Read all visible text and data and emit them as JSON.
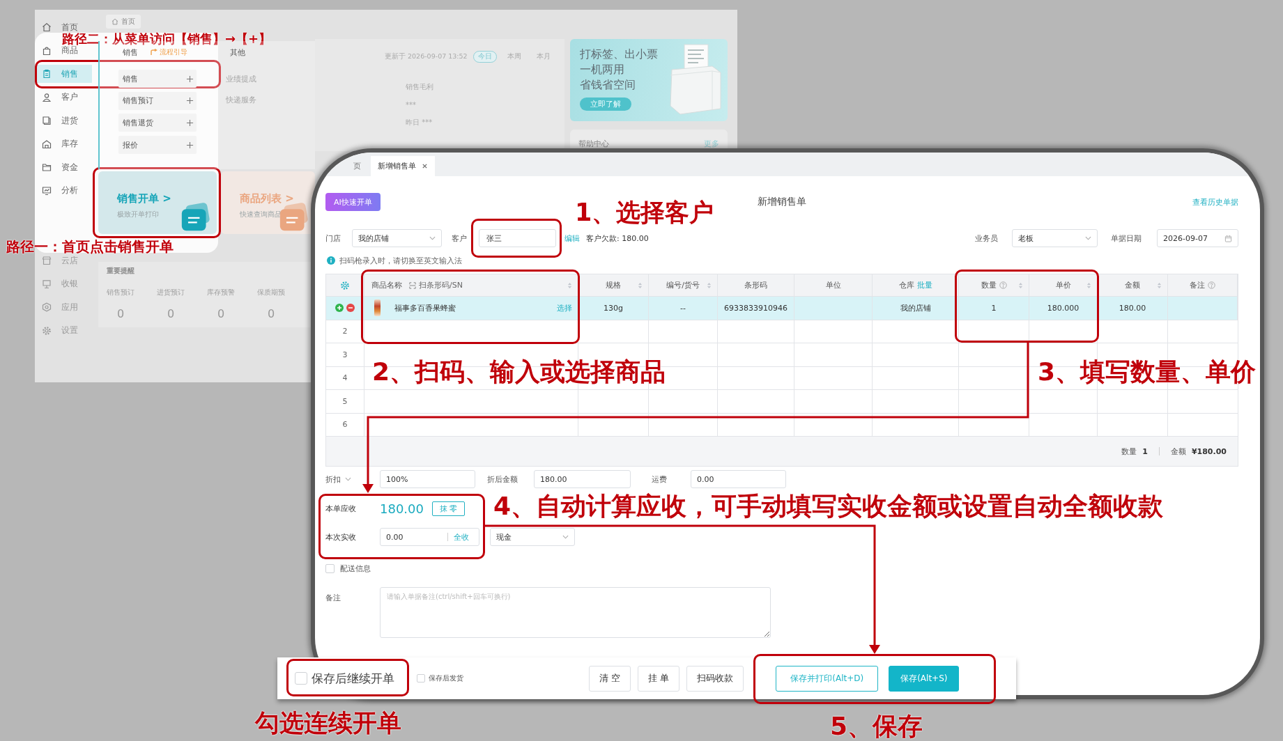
{
  "background_app": {
    "sidebar": {
      "main_items": [
        {
          "label": "首页",
          "selected": false
        },
        {
          "label": "商品",
          "selected": false
        },
        {
          "label": "销售",
          "selected": true
        },
        {
          "label": "客户",
          "selected": false
        },
        {
          "label": "进货",
          "selected": false
        },
        {
          "label": "库存",
          "selected": false
        },
        {
          "label": "资金",
          "selected": false
        },
        {
          "label": "分析",
          "selected": false
        }
      ],
      "more_items": [
        {
          "label": "云店",
          "selected": false
        },
        {
          "label": "收银",
          "selected": false
        },
        {
          "label": "应用",
          "selected": false
        },
        {
          "label": "设置",
          "selected": false
        }
      ]
    },
    "tabs": [
      {
        "label": "首页",
        "selected": true
      }
    ],
    "menu": {
      "columns": [
        {
          "title": "销售",
          "guide": "流程引导",
          "kind": "actions",
          "items": [
            "销售",
            "销售预订",
            "销售退货",
            "报价"
          ]
        },
        {
          "title": "其他",
          "kind": "links",
          "items": [
            "业绩提成",
            "快递服务"
          ]
        }
      ]
    },
    "stats": {
      "updated": "更新于 2026-09-07 13:52",
      "periods": [
        {
          "label": "今日",
          "selected": true
        },
        {
          "label": "本周",
          "selected": false
        },
        {
          "label": "本月",
          "selected": false
        }
      ],
      "metric": "销售毛利",
      "metric_value": "***",
      "yesterday": "昨日 ***"
    },
    "promo": {
      "lines": [
        "打标签、出小票",
        "一机两用",
        "省钱省空间"
      ],
      "button": "立即了解"
    },
    "help": {
      "title": "帮助中心",
      "more": "更多"
    },
    "shortcuts": [
      {
        "title": "销售开单 >",
        "subtitle": "极致开单打印",
        "color": "#17a5b8"
      },
      {
        "title": "商品列表 >",
        "subtitle": "快速查询商品",
        "color": "#eaa680"
      }
    ],
    "reminders": {
      "title": "重要提醒",
      "items": [
        {
          "label": "销售预订",
          "value": "0"
        },
        {
          "label": "进货预订",
          "value": "0"
        },
        {
          "label": "库存预警",
          "value": "0"
        },
        {
          "label": "保质期预",
          "value": "0"
        }
      ]
    }
  },
  "sales_window": {
    "tabs": [
      {
        "label": "页",
        "selected": false,
        "closable": false
      },
      {
        "label": "新增销售单",
        "selected": true,
        "closable": true
      }
    ],
    "ai_button": "AI快速开单",
    "title": "新增销售单",
    "history_link": "查看历史单据",
    "store": {
      "label": "门店",
      "value": "我的店铺"
    },
    "customer": {
      "label": "客户",
      "value": "张三",
      "edit_link": "编辑",
      "debt": "客户欠款: 180.00"
    },
    "salesperson": {
      "label": "业务员",
      "value": "老板"
    },
    "date": {
      "label": "单据日期",
      "value": "2026-09-07"
    },
    "hint": "扫码枪录入时，请切换至英文输入法",
    "table": {
      "columns": [
        {
          "label": "商品名称",
          "scan": "扫条形码/SN",
          "sortable": true,
          "help": false
        },
        {
          "label": "规格",
          "sortable": true,
          "help": false
        },
        {
          "label": "编号/货号",
          "sortable": true,
          "help": false
        },
        {
          "label": "条形码",
          "sortable": false,
          "help": false
        },
        {
          "label": "单位",
          "sortable": false,
          "help": false
        },
        {
          "label": "仓库",
          "link": "批量",
          "sortable": false,
          "help": false
        },
        {
          "label": "数量",
          "sortable": true,
          "help": true
        },
        {
          "label": "单价",
          "sortable": true,
          "help": false
        },
        {
          "label": "金额",
          "sortable": true,
          "help": false
        },
        {
          "label": "备注",
          "sortable": false,
          "help": true
        }
      ],
      "rows": [
        {
          "kind": "item",
          "selected": true,
          "product": "福事多百香果蜂蜜",
          "select_link": "选择",
          "cells": [
            "130g",
            "--",
            "6933833910946",
            null,
            "我的店铺",
            "1",
            "180.000",
            "180.00",
            null
          ]
        },
        {
          "kind": "empty",
          "selected": false,
          "number": "2"
        },
        {
          "kind": "empty",
          "selected": false,
          "number": "3"
        },
        {
          "kind": "empty",
          "selected": false,
          "number": "4"
        },
        {
          "kind": "empty",
          "selected": false,
          "number": "5"
        },
        {
          "kind": "empty",
          "selected": false,
          "number": "6"
        }
      ],
      "footer": {
        "quantity_label": "数量",
        "quantity": "1",
        "amount_label": "金额",
        "amount": "¥180.00"
      }
    },
    "discount": {
      "label": "折扣",
      "value": "100%"
    },
    "discounted_amount": {
      "label": "折后金额",
      "value": "180.00"
    },
    "shipping": {
      "label": "运费",
      "value": "0.00"
    },
    "receivable": {
      "label": "本单应收",
      "amount": "180.00",
      "round_button": "抹 零"
    },
    "received": {
      "label": "本次实收",
      "value": "0.00",
      "full_button": "全收",
      "method": "现金"
    },
    "delivery": {
      "label": "配送信息",
      "checked": false
    },
    "note": {
      "label": "备注",
      "placeholder": "请输入单据备注(ctrl/shift+回车可换行)"
    },
    "bottom_bar": {
      "options": [
        {
          "label": "保存后继续开单",
          "checked": false,
          "kind": "large"
        },
        {
          "label": "保存后发货",
          "checked": false,
          "kind": "small"
        }
      ],
      "buttons": [
        {
          "label": "清 空",
          "kind": "plain"
        },
        {
          "label": "挂 单",
          "kind": "plain"
        },
        {
          "label": "扫码收款",
          "kind": "plain"
        },
        {
          "label": "保存并打印(Alt+D)",
          "kind": "outline"
        },
        {
          "label": "保存(Alt+S)",
          "kind": "primary"
        }
      ]
    }
  },
  "annotations": [
    "路径二：从菜单访问【销售】→【+】",
    "路径一：首页点击销售开单",
    "1、选择客户",
    "2、扫码、输入或选择商品",
    "3、填写数量、单价",
    "4、自动计算应收，可手动填写实收金额或设置自动全额收款",
    "勾选连续开单",
    "5、保存"
  ]
}
